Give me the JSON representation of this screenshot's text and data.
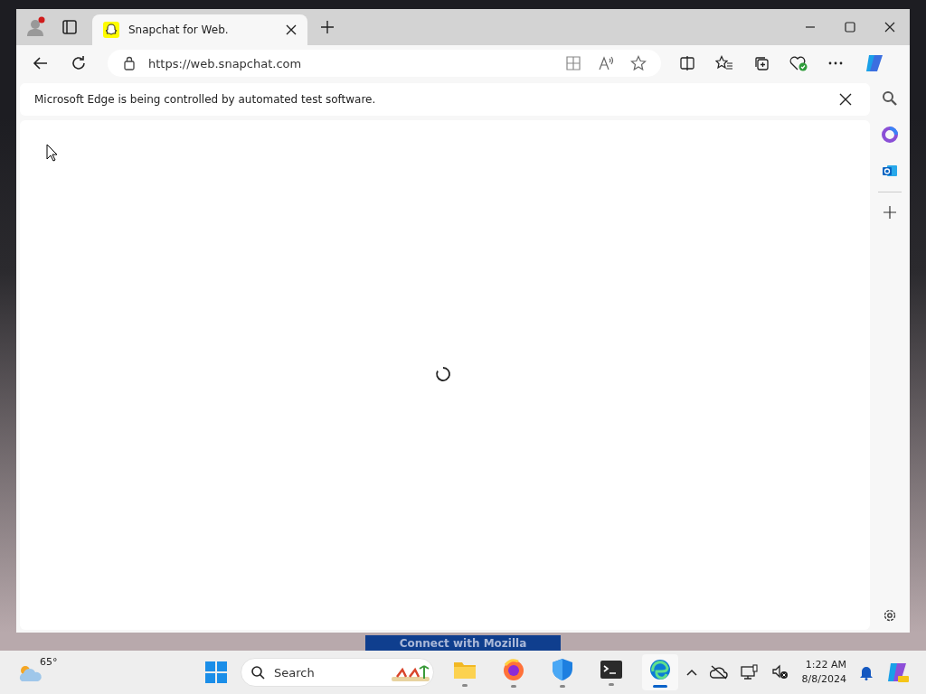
{
  "browser": {
    "tabs": [
      {
        "title": "Snapchat for Web.",
        "selected": true
      }
    ],
    "address": "https://web.snapchat.com",
    "infobar": "Microsoft Edge is being controlled by automated test software."
  },
  "background_button": "Connect with Mozilla",
  "taskbar": {
    "weather": "65°",
    "search": {
      "placeholder": "Search"
    },
    "apps": [
      {
        "kind": "files",
        "active": false
      },
      {
        "kind": "firefox",
        "active": false
      },
      {
        "kind": "defender",
        "active": false
      },
      {
        "kind": "terminal",
        "active": false
      },
      {
        "kind": "edge",
        "active": true
      }
    ],
    "time": "1:22 AM",
    "date": "8/8/2024"
  }
}
